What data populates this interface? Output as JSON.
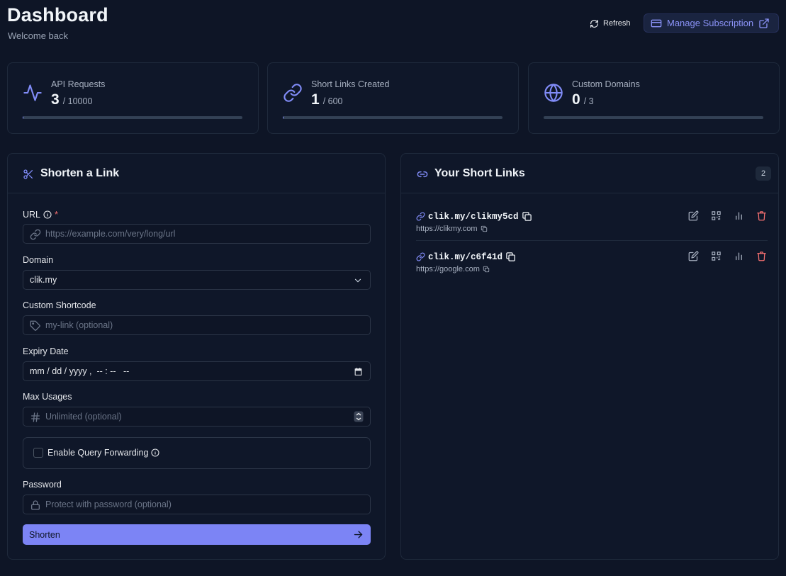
{
  "header": {
    "title": "Dashboard",
    "subtitle": "Welcome back",
    "refresh_label": "Refresh",
    "manage_label": "Manage Subscription"
  },
  "stats": [
    {
      "label": "API Requests",
      "value": "3",
      "max": "/ 10000",
      "progress": 0.0003,
      "icon": "activity-icon"
    },
    {
      "label": "Short Links Created",
      "value": "1",
      "max": "/ 600",
      "progress": 0.0017,
      "icon": "link-icon"
    },
    {
      "label": "Custom Domains",
      "value": "0",
      "max": "/ 3",
      "progress": 0,
      "icon": "globe-icon"
    }
  ],
  "form": {
    "title": "Shorten a Link",
    "url_label": "URL",
    "url_required": "*",
    "url_placeholder": "https://example.com/very/long/url",
    "domain_label": "Domain",
    "domain_value": "clik.my",
    "shortcode_label": "Custom Shortcode",
    "shortcode_placeholder": "my-link (optional)",
    "expiry_label": "Expiry Date",
    "expiry_value": "mm / dd / yyyy ,  -- : --   --",
    "max_label": "Max Usages",
    "max_placeholder": "Unlimited (optional)",
    "forwarding_label": "Enable Query Forwarding",
    "password_label": "Password",
    "password_placeholder": "Protect with password (optional)",
    "submit_label": "Shorten"
  },
  "links": {
    "title": "Your Short Links",
    "count": "2",
    "items": [
      {
        "short": "clik.my/clikmy5cd",
        "dest": "https://clikmy.com"
      },
      {
        "short": "clik.my/c6f41d",
        "dest": "https://google.com"
      }
    ]
  },
  "colors": {
    "background": "#0e1526",
    "card": "#0f1729",
    "accent": "#818cf8",
    "danger": "#f87171"
  }
}
